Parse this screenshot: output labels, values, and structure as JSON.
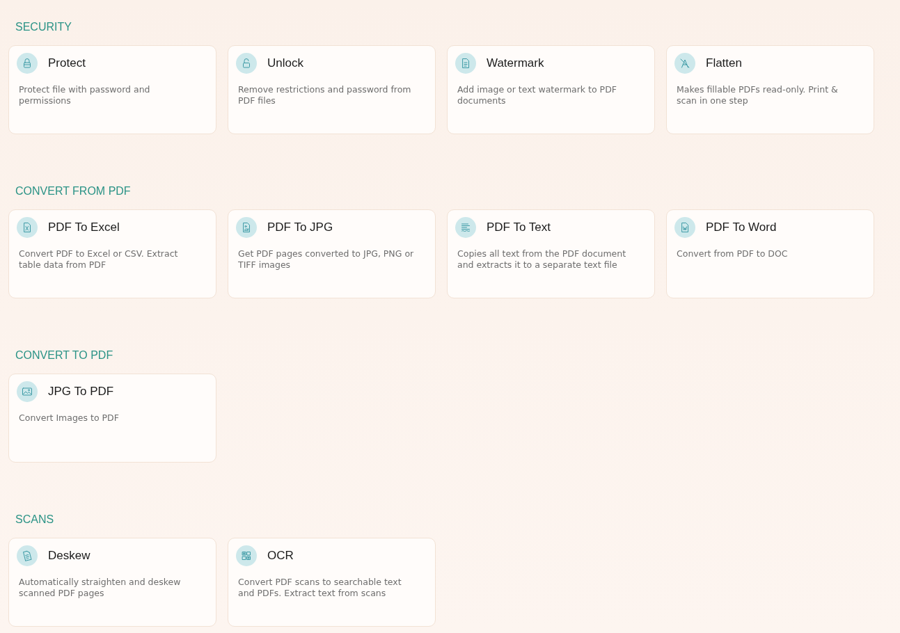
{
  "sections": [
    {
      "title": "SECURITY",
      "tools": [
        {
          "title": "Protect",
          "description": "Protect file with password and permissions"
        },
        {
          "title": "Unlock",
          "description": "Remove restrictions and password from PDF files"
        },
        {
          "title": "Watermark",
          "description": "Add image or text watermark to PDF documents"
        },
        {
          "title": "Flatten",
          "description": "Makes fillable PDFs read-only. Print & scan in one step"
        }
      ]
    },
    {
      "title": "CONVERT FROM PDF",
      "tools": [
        {
          "title": "PDF To Excel",
          "description": "Convert PDF to Excel or CSV. Extract table data from PDF"
        },
        {
          "title": "PDF To JPG",
          "description": "Get PDF pages converted to JPG, PNG or TIFF images"
        },
        {
          "title": "PDF To Text",
          "description": "Copies all text from the PDF document and extracts it to a separate text file"
        },
        {
          "title": "PDF To Word",
          "description": "Convert from PDF to DOC"
        }
      ]
    },
    {
      "title": "CONVERT TO PDF",
      "tools": [
        {
          "title": "JPG To PDF",
          "description": "Convert Images to PDF"
        }
      ]
    },
    {
      "title": "SCANS",
      "tools": [
        {
          "title": "Deskew",
          "description": "Automatically straighten and deskew scanned PDF pages"
        },
        {
          "title": "OCR",
          "description": "Convert PDF scans to searchable text and PDFs. Extract text from scans"
        }
      ]
    }
  ]
}
